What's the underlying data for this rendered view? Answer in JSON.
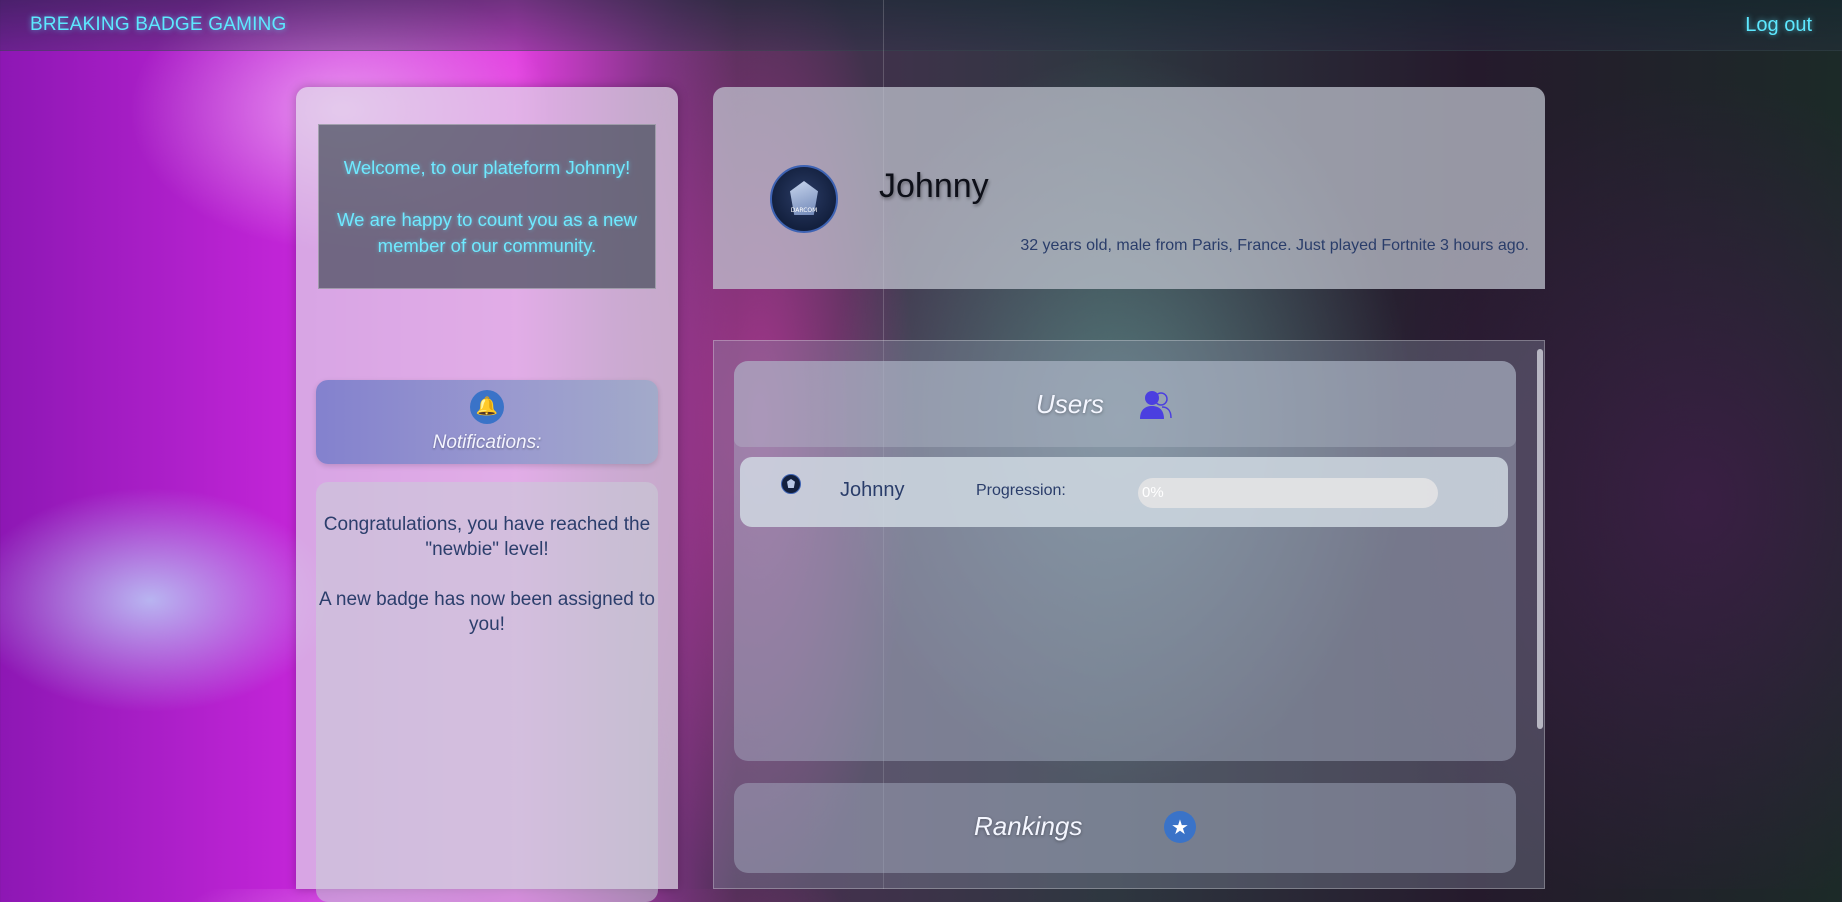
{
  "header": {
    "brand": "BREAKING BADGE GAMING",
    "logout_label": "Log out"
  },
  "welcome": {
    "line1": "Welcome, to our plateform Johnny!",
    "line2": "We are happy to count you as a new member of our community."
  },
  "notifications": {
    "icon": "bell-icon",
    "title": "Notifications:",
    "message1": "Congratulations, you have reached the \"newbie\" level!",
    "message2": "A new badge has now been assigned to you!"
  },
  "profile": {
    "name": "Johnny",
    "description": "32 years old, male from Paris, France. Just played Fortnite 3 hours ago.",
    "avatar_text": "DARCOM"
  },
  "users": {
    "title": "Users",
    "icon": "users-icon",
    "rows": [
      {
        "name": "Johnny",
        "progress_label": "Progression:",
        "progress_text": "0%",
        "progress_value": 0
      }
    ]
  },
  "rankings": {
    "title": "Rankings",
    "icon": "star-icon"
  },
  "colors": {
    "accent": "#5de8ff",
    "text_dark": "#2a3d6a",
    "icon_blue": "#3a73c8"
  }
}
